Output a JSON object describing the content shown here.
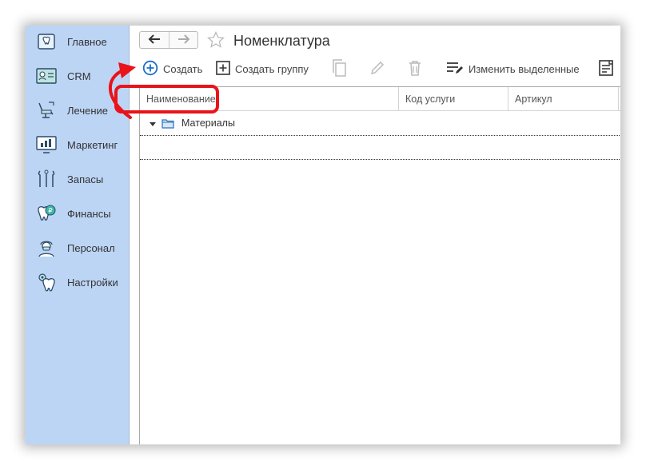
{
  "sidebar": {
    "items": [
      {
        "label": "Главное",
        "icon": "home-tooth-icon"
      },
      {
        "label": "CRM",
        "icon": "crm-card-icon"
      },
      {
        "label": "Лечение",
        "icon": "dental-chair-icon"
      },
      {
        "label": "Маркетинг",
        "icon": "marketing-chart-icon"
      },
      {
        "label": "Запасы",
        "icon": "dental-tools-icon"
      },
      {
        "label": "Финансы",
        "icon": "tooth-ruble-icon"
      },
      {
        "label": "Персонал",
        "icon": "doctor-icon"
      },
      {
        "label": "Настройки",
        "icon": "tooth-gear-icon"
      }
    ]
  },
  "header": {
    "title": "Номенклатура"
  },
  "toolbar": {
    "create_label": "Создать",
    "create_group_label": "Создать группу",
    "change_selected_label": "Изменить выделенные"
  },
  "grid": {
    "columns": [
      "Наименование",
      "Код услуги",
      "Артикул"
    ],
    "rows": [
      {
        "name": "Материалы",
        "type": "group",
        "expanded": true
      }
    ]
  },
  "colors": {
    "sidebar_bg": "#bdd5f5",
    "accent_blue": "#1a6fc6",
    "highlight_red": "#e8141a"
  }
}
